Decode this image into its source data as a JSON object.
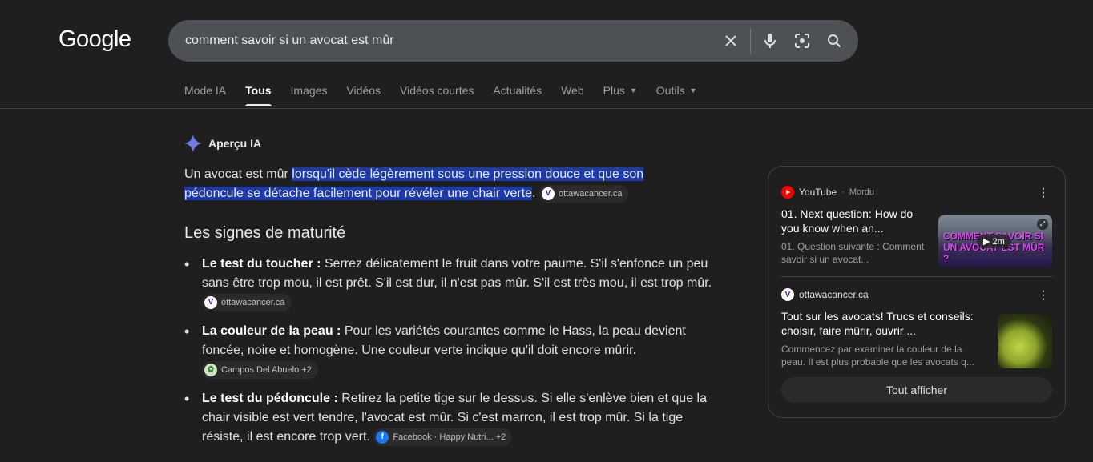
{
  "logo": "Google",
  "search": {
    "query": "comment savoir si un avocat est mûr"
  },
  "tabs": [
    {
      "label": "Mode IA"
    },
    {
      "label": "Tous"
    },
    {
      "label": "Images"
    },
    {
      "label": "Vidéos"
    },
    {
      "label": "Vidéos courtes"
    },
    {
      "label": "Actualités"
    },
    {
      "label": "Web"
    },
    {
      "label": "Plus"
    },
    {
      "label": "Outils"
    }
  ],
  "ai_overview": {
    "label": "Aperçu IA",
    "summary_prefix": "Un avocat est mûr ",
    "summary_highlight": "lorsqu'il cède légèrement sous une pression douce et que son pédoncule se détache facilement pour révéler une chair verte",
    "summary_suffix": ".",
    "summary_source": "ottawacancer.ca",
    "section_title": "Les signes de maturité",
    "bullets": [
      {
        "title": "Le test du toucher :",
        "text": " Serrez délicatement le fruit dans votre paume. S'il s'enfonce un peu sans être trop mou, il est prêt. S'il est dur, il n'est pas mûr. S'il est très mou, il est trop mûr.",
        "source": "ottawacancer.ca"
      },
      {
        "title": "La couleur de la peau :",
        "text": " Pour les variétés courantes comme le Hass, la peau devient foncée, noire et homogène. Une couleur verte indique qu'il doit encore mûrir.",
        "source": "Campos Del Abuelo +2"
      },
      {
        "title": "Le test du pédoncule :",
        "text": " Retirez la petite tige sur le dessus. Si elle s'enlève bien et que la chair visible est vert tendre, l'avocat est mûr. Si c'est marron, il est trop mûr. Si la tige résiste, il est encore trop vert.",
        "source": "Facebook · Happy Nutri... +2"
      }
    ]
  },
  "sources_panel": {
    "cards": [
      {
        "source": "YouTube",
        "author": "Mordu",
        "title": "01. Next question: How do you know when an...",
        "desc": "01. Question suivante : Comment savoir si un avocat...",
        "duration": "2m",
        "thumb_line1": "COMMENT SAVOIR SI",
        "thumb_line2": "UN AVOCAT EST MÛR ?"
      },
      {
        "source": "ottawacancer.ca",
        "title": "Tout sur les avocats! Trucs et conseils: choisir, faire mûrir, ouvrir ...",
        "desc": "Commencez par examiner la couleur de la peau. Il est plus probable que les avocats q..."
      }
    ],
    "show_all": "Tout afficher"
  },
  "colors": {
    "background": "#1f1f1f",
    "highlight": "#1c3aa9",
    "searchbar": "#4d5156"
  }
}
